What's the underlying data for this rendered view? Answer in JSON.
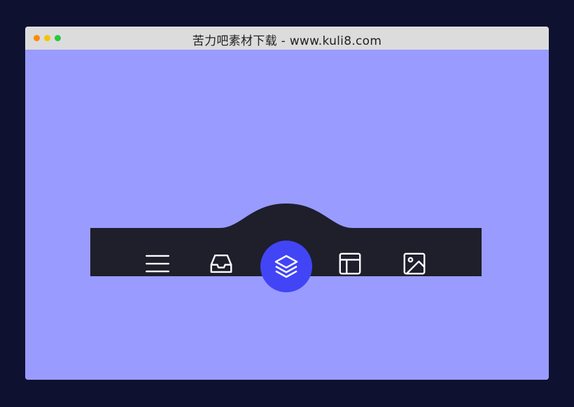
{
  "window": {
    "title": "苦力吧素材下载 - www.kuli8.com",
    "traffic_lights": [
      "#ff8a00",
      "#f5c400",
      "#27c93f"
    ]
  },
  "colors": {
    "page_background": "#0e1230",
    "content_background": "#999bff",
    "navbar_background": "#1e1f2b",
    "active_indicator": "#4245f5",
    "icon_color": "#ffffff"
  },
  "navbar": {
    "active_index": 2,
    "items": [
      {
        "icon": "menu-icon"
      },
      {
        "icon": "inbox-icon"
      },
      {
        "icon": "layers-icon"
      },
      {
        "icon": "layout-icon"
      },
      {
        "icon": "image-icon"
      }
    ]
  }
}
